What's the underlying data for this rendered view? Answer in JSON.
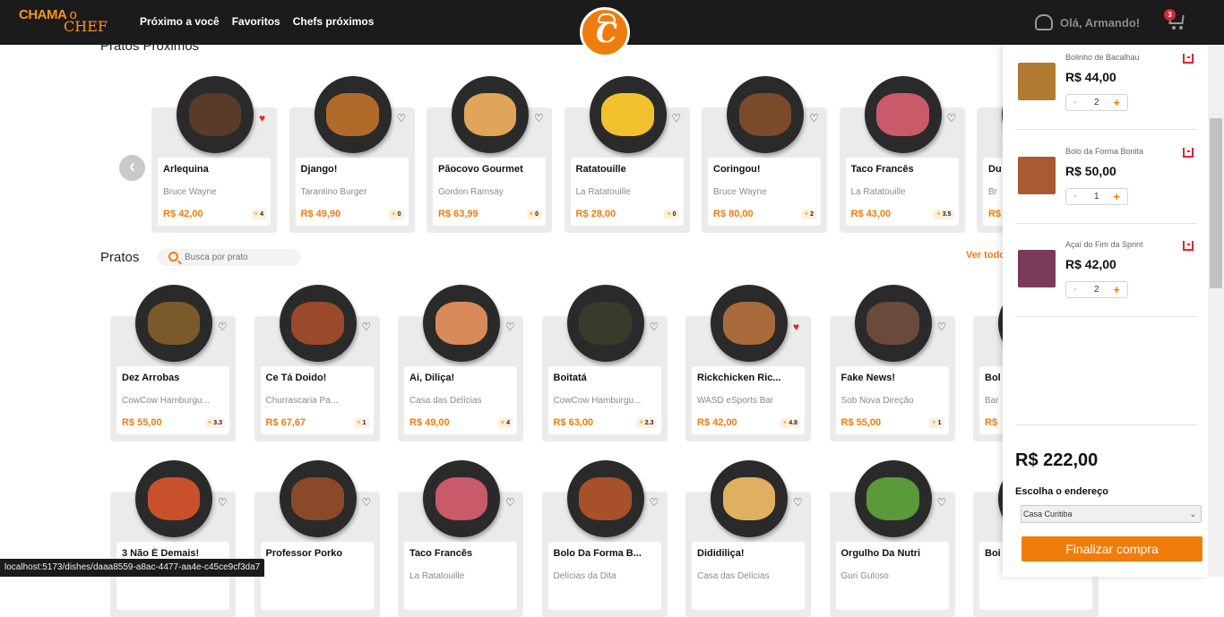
{
  "header": {
    "logo_line1": "CHAMA",
    "logo_o": "o",
    "logo_line2": "CHEF",
    "nav": [
      "Próximo a você",
      "Favoritos",
      "Chefs próximos"
    ],
    "center_logo_letter": "C",
    "greeting": "Olá, Armando!",
    "cart_count": "3"
  },
  "nearby": {
    "title": "Pratos Próximos",
    "prev_arrow": "‹",
    "items": [
      {
        "name": "Arlequina",
        "chef": "Bruce Wayne",
        "price": "R$ 42,00",
        "rating": "4",
        "fav": true,
        "color": "#5a3a28"
      },
      {
        "name": "Django!",
        "chef": "Tarantino Burger",
        "price": "R$ 49,90",
        "rating": "0",
        "fav": false,
        "color": "#b06a2a"
      },
      {
        "name": "Pãocovo Gourmet",
        "chef": "Gordon Ramsay",
        "price": "R$ 63,99",
        "rating": "0",
        "fav": false,
        "color": "#e0a55a"
      },
      {
        "name": "Ratatouille",
        "chef": "La Ratatouille",
        "price": "R$ 28,00",
        "rating": "0",
        "fav": false,
        "color": "#f2c12e"
      },
      {
        "name": "Coringou!",
        "chef": "Bruce Wayne",
        "price": "R$ 80,00",
        "rating": "2",
        "fav": false,
        "color": "#7a4a2a"
      },
      {
        "name": "Taco Francês",
        "chef": "La Ratatouille",
        "price": "R$ 43,00",
        "rating": "3.5",
        "fav": false,
        "color": "#c85a6a"
      },
      {
        "name": "Du",
        "chef": "Br",
        "price": "R$",
        "rating": "",
        "fav": false,
        "color": "#333333"
      }
    ]
  },
  "dishes": {
    "title": "Pratos",
    "search_placeholder": "Busca por prato",
    "see_all": "Ver todos",
    "row1": [
      {
        "name": "Dez Arrobas",
        "chef": "CowCow Hamburgu...",
        "price": "R$ 55,00",
        "rating": "3.3",
        "fav": false,
        "color": "#7a5a2a"
      },
      {
        "name": "Ce Tá Doido!",
        "chef": "Churrascaria Pa...",
        "price": "R$ 67,67",
        "rating": "1",
        "fav": false,
        "color": "#9a4a2a"
      },
      {
        "name": "Ai, Diliça!",
        "chef": "Casa das Delícias",
        "price": "R$ 49,00",
        "rating": "4",
        "fav": false,
        "color": "#d88a5a"
      },
      {
        "name": "Boitatá",
        "chef": "CowCow Hamburgu...",
        "price": "R$ 63,00",
        "rating": "2.3",
        "fav": false,
        "color": "#3a3a2a"
      },
      {
        "name": "Rickchicken Ric...",
        "chef": "WASD eSports Bar",
        "price": "R$ 42,00",
        "rating": "4.8",
        "fav": true,
        "color": "#a86a3a"
      },
      {
        "name": "Fake News!",
        "chef": "Sob Nova Direção",
        "price": "R$ 55,00",
        "rating": "1",
        "fav": false,
        "color": "#6a4a3a"
      },
      {
        "name": "Bol",
        "chef": "Bar",
        "price": "R$",
        "rating": "",
        "fav": false,
        "color": "#c8a060"
      }
    ],
    "row2": [
      {
        "name": "3 Não É Demais!",
        "chef": "",
        "color": "#c8502a"
      },
      {
        "name": "Professor Porko",
        "chef": "",
        "color": "#8a4a2a"
      },
      {
        "name": "Taco Francês",
        "chef": "La Ratatouille",
        "color": "#c85a6a"
      },
      {
        "name": "Bolo Da Forma B...",
        "chef": "Delícias da Dita",
        "color": "#a8502a"
      },
      {
        "name": "Dididiliça!",
        "chef": "Casa das Delícias",
        "color": "#e0b060"
      },
      {
        "name": "Orgulho Da Nutri",
        "chef": "Guri Guloso",
        "color": "#5a9a3a"
      },
      {
        "name": "Boi",
        "chef": "",
        "color": "#333333"
      }
    ]
  },
  "cart": {
    "items": [
      {
        "name": "Bolinho de Bacalhau",
        "price": "R$ 44,00",
        "qty": "2",
        "color": "#b07a30"
      },
      {
        "name": "Bolo da Forma Bonita",
        "price": "R$ 50,00",
        "qty": "1",
        "color": "#a85a30"
      },
      {
        "name": "Açaí do Fim da Sprint",
        "price": "R$ 42,00",
        "qty": "2",
        "color": "#7a3a5a"
      }
    ],
    "minus": "-",
    "plus": "+",
    "total": "R$ 222,00",
    "address_label": "Escolha o endereço",
    "address_value": "Casa Curitiba",
    "checkout_label": "Finalizar compra"
  },
  "status_url": "localhost:5173/dishes/daaa8559-a8ac-4477-aa4e-c45ce9cf3da7",
  "colors": {
    "accent": "#f07d0b",
    "topbar": "#1b1b1b",
    "favorite": "#e0242f"
  }
}
